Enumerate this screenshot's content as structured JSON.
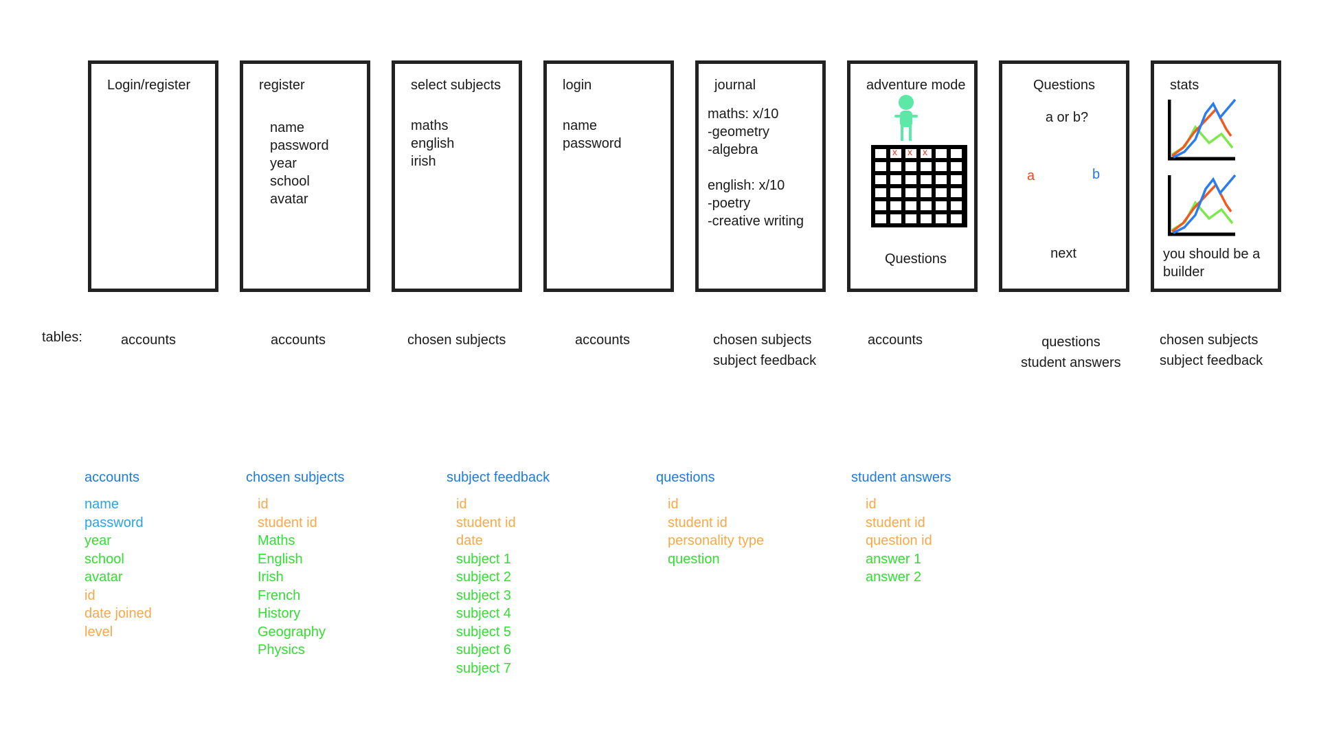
{
  "screens": [
    {
      "title": "Login/register",
      "lines": []
    },
    {
      "title": "register",
      "lines": [
        "name",
        "password",
        "year",
        "school",
        "avatar"
      ]
    },
    {
      "title": "select subjects",
      "lines": [
        "maths",
        "english",
        "irish"
      ]
    },
    {
      "title": "login",
      "lines": [
        "name",
        "password"
      ]
    },
    {
      "title": "journal",
      "lines": [
        "maths: x/10",
        "-geometry",
        "-algebra",
        "",
        "english: x/10",
        "-poetry",
        "-creative writing"
      ]
    },
    {
      "title": "adventure mode",
      "footer": "Questions",
      "grid_marks": [
        "x",
        "x",
        "x"
      ]
    },
    {
      "title": "Questions",
      "prompt": "a or b?",
      "option_a": "a",
      "option_b": "b",
      "next": "next"
    },
    {
      "title": "stats",
      "caption_line1": "you should be a",
      "caption_line2": "builder"
    }
  ],
  "tables_label": "tables:",
  "screen_tables": [
    [
      "accounts"
    ],
    [
      "accounts"
    ],
    [
      "chosen subjects"
    ],
    [
      "accounts"
    ],
    [
      "chosen subjects",
      "subject feedback"
    ],
    [
      "accounts"
    ],
    [
      "questions",
      "student answers"
    ],
    [
      "chosen subjects",
      "subject feedback"
    ]
  ],
  "schemas": [
    {
      "title": "accounts",
      "fields": [
        {
          "name": "name",
          "color": "blue"
        },
        {
          "name": "password",
          "color": "blue"
        },
        {
          "name": "year",
          "color": "green"
        },
        {
          "name": "school",
          "color": "green"
        },
        {
          "name": "avatar",
          "color": "green"
        },
        {
          "name": "id",
          "color": "orange"
        },
        {
          "name": "date joined",
          "color": "orange"
        },
        {
          "name": "level",
          "color": "orange"
        }
      ]
    },
    {
      "title": "chosen subjects",
      "fields": [
        {
          "name": "id",
          "color": "orange"
        },
        {
          "name": "student id",
          "color": "orange"
        },
        {
          "name": "Maths",
          "color": "green"
        },
        {
          "name": "English",
          "color": "green"
        },
        {
          "name": "Irish",
          "color": "green"
        },
        {
          "name": "French",
          "color": "green"
        },
        {
          "name": "History",
          "color": "green"
        },
        {
          "name": "Geography",
          "color": "green"
        },
        {
          "name": "Physics",
          "color": "green"
        }
      ]
    },
    {
      "title": "subject feedback",
      "fields": [
        {
          "name": "id",
          "color": "orange"
        },
        {
          "name": "student id",
          "color": "orange"
        },
        {
          "name": "date",
          "color": "orange"
        },
        {
          "name": "subject 1",
          "color": "green"
        },
        {
          "name": "subject 2",
          "color": "green"
        },
        {
          "name": "subject 3",
          "color": "green"
        },
        {
          "name": "subject 4",
          "color": "green"
        },
        {
          "name": "subject 5",
          "color": "green"
        },
        {
          "name": "subject 6",
          "color": "green"
        },
        {
          "name": "subject 7",
          "color": "green"
        }
      ]
    },
    {
      "title": "questions",
      "fields": [
        {
          "name": "id",
          "color": "orange"
        },
        {
          "name": "student id",
          "color": "orange"
        },
        {
          "name": "personality type",
          "color": "orange"
        },
        {
          "name": "question",
          "color": "green"
        }
      ]
    },
    {
      "title": "student answers",
      "fields": [
        {
          "name": "id",
          "color": "orange"
        },
        {
          "name": "student id",
          "color": "orange"
        },
        {
          "name": "question id",
          "color": "orange"
        },
        {
          "name": "answer 1",
          "color": "green"
        },
        {
          "name": "answer 2",
          "color": "green"
        }
      ]
    }
  ],
  "colors": {
    "schema_title": "#1d7be0",
    "blue": "#29a4e8",
    "green": "#33dd33",
    "orange": "#f7a84a",
    "frame": "#222222",
    "option_a": "#e8491d",
    "option_b": "#1d7be0",
    "avatar": "#5ee8a8",
    "grid_mark": "#e83a1d",
    "chart_red": "#f05a1e",
    "chart_blue": "#2b7cf0",
    "chart_green": "#7de84a"
  },
  "icons": [
    "avatar-figure-icon",
    "grid-board-icon",
    "line-chart-icon"
  ]
}
